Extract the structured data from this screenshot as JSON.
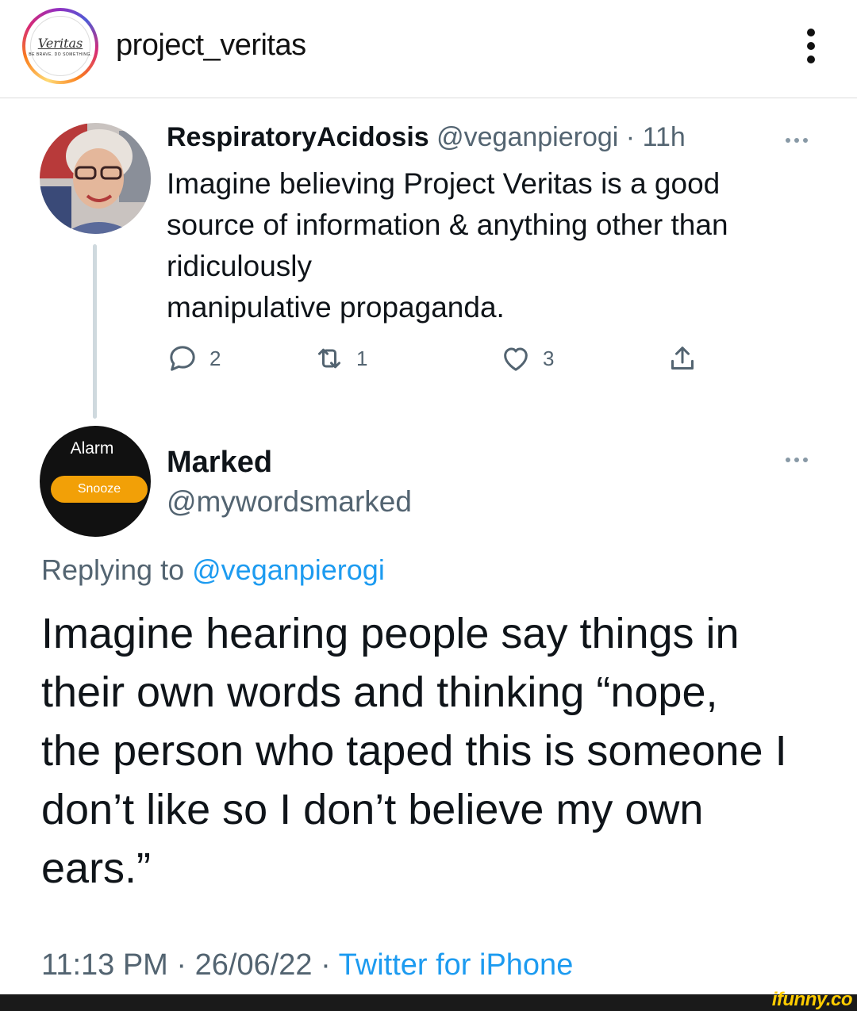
{
  "instagram": {
    "username": "project_veritas",
    "avatar_logo_text": "Veritas",
    "avatar_tagline": "BE BRAVE. DO SOMETHING.",
    "more_icon": "vertical-ellipsis-icon"
  },
  "tweet_parent": {
    "display_name": "RespiratoryAcidosis",
    "handle": "@veganpierogi",
    "separator": "·",
    "time_ago": "11h",
    "text_lines": [
      "Imagine believing Project Veritas is a good",
      "source of information & anything other than",
      "ridiculously",
      "manipulative propaganda."
    ],
    "actions": {
      "reply_count": "2",
      "retweet_count": "1",
      "like_count": "3"
    }
  },
  "tweet_main": {
    "avatar_alarm_label": "Alarm",
    "avatar_snooze_label": "Snooze",
    "display_name": "Marked",
    "handle": "@mywordsmarked",
    "replying_prefix": "Replying to",
    "replying_to": "@veganpierogi",
    "text_lines": [
      "Imagine hearing people say things in",
      "their own words and thinking “nope,",
      "the person who taped this is someone I",
      "don’t like so I don’t believe my own",
      "ears.”"
    ],
    "time": "11:13 PM",
    "separator": "·",
    "date": "26/06/22",
    "source": "Twitter for iPhone"
  },
  "watermark": "ifunny.co",
  "colors": {
    "text_primary": "#0f1419",
    "text_secondary": "#536471",
    "link_blue": "#1d9bf0",
    "snooze_orange": "#f2a007",
    "watermark_yellow": "#ffcc00"
  }
}
